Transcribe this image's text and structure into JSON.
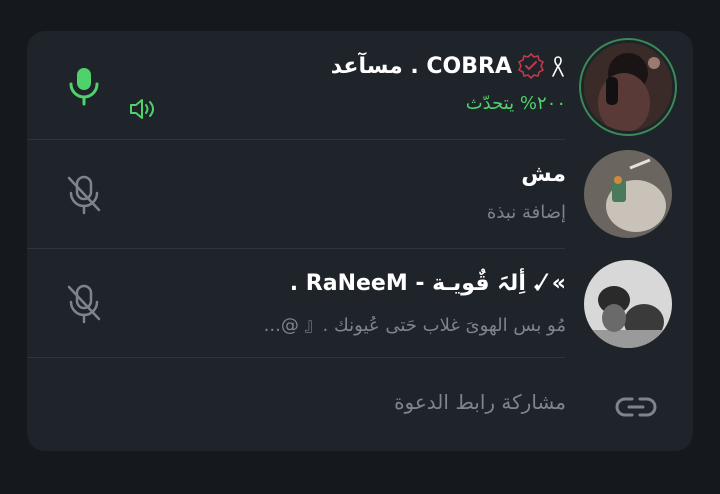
{
  "participants": [
    {
      "name": "COBRA . مسآعد",
      "status": "٢٠٠% يتحدّث",
      "speaking": true,
      "verified_badge": "verified-badge-icon",
      "ribbon": "ribbon-icon",
      "mic_state": "mic-active-icon",
      "volume_icon": "speaker-volume-icon"
    },
    {
      "name": "مش",
      "status": "إضافة نبذة",
      "speaking": false,
      "mic_state": "mic-muted-icon"
    },
    {
      "name": "» ⁄𝆺 أِلہَ قٌويـة - RaNeeM .",
      "status": "مُو بس الهوىَ غلاب حَتى عُيونك .『 @...",
      "speaking": false,
      "mic_state": "mic-muted-icon"
    }
  ],
  "invite": {
    "label": "مشاركة رابط الدعوة",
    "icon": "link-icon"
  },
  "colors": {
    "background": "#15181c",
    "panel": "#1f242a",
    "speaking_green": "#4fd16b",
    "muted_gray": "#7d848c",
    "badge_red": "#c0394b"
  }
}
